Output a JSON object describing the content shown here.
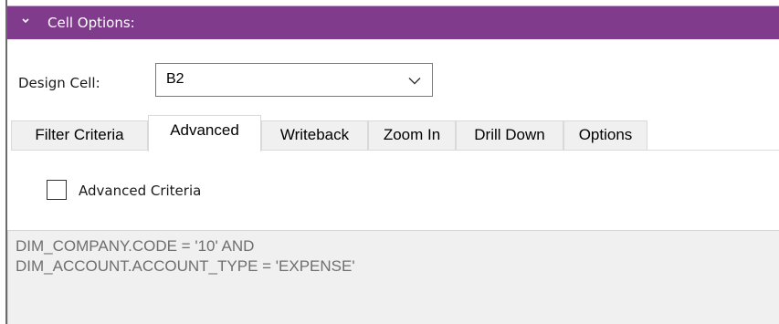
{
  "header": {
    "title": "Cell Options:",
    "bg_color": "#803b8d"
  },
  "design_cell": {
    "label": "Design Cell:",
    "value": "B2"
  },
  "tabs": [
    {
      "label": "Filter Criteria",
      "active": false
    },
    {
      "label": "Advanced",
      "active": true
    },
    {
      "label": "Writeback",
      "active": false
    },
    {
      "label": "Zoom In",
      "active": false
    },
    {
      "label": "Drill Down",
      "active": false
    },
    {
      "label": "Options",
      "active": false
    }
  ],
  "advanced": {
    "checkbox_label": "Advanced Criteria",
    "checked": false,
    "criteria_lines": [
      "DIM_COMPANY.CODE = '10' AND",
      "DIM_ACCOUNT.ACCOUNT_TYPE = 'EXPENSE'"
    ]
  },
  "icons": {
    "header_toggle": "chevron-down-icon",
    "dropdown": "chevron-down-icon"
  }
}
